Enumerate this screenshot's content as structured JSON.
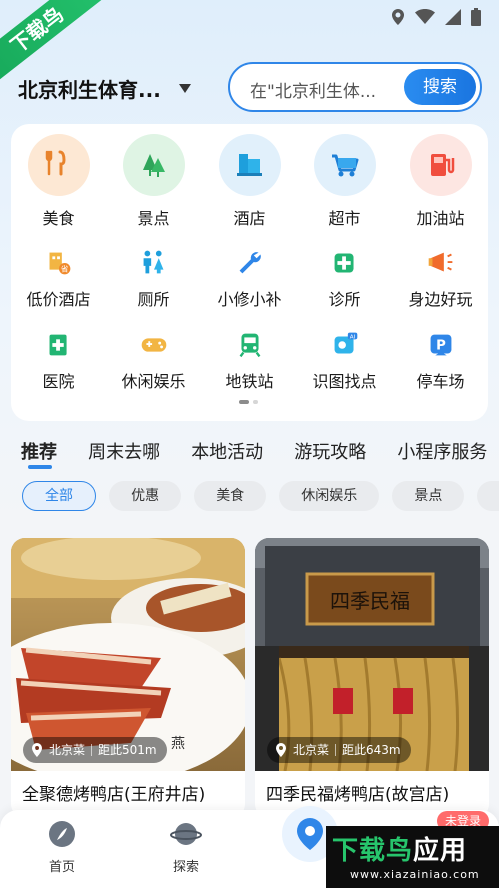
{
  "watermark": {
    "ribbon": "下载鸟",
    "brand_a": "下载鸟",
    "brand_b": "应用",
    "url": "www.xiazainiao.com"
  },
  "status_bar": {
    "icons": [
      "location-icon",
      "wifi-icon",
      "signal-icon",
      "battery-icon"
    ]
  },
  "location": {
    "city": "北京利生体育...",
    "caret": "chevron-down-icon"
  },
  "search": {
    "placeholder": "在\"北京利生体...",
    "button": "搜索"
  },
  "categories": [
    {
      "label": "美食",
      "icon": "food-icon"
    },
    {
      "label": "景点",
      "icon": "scenic-icon"
    },
    {
      "label": "酒店",
      "icon": "hotel-icon"
    },
    {
      "label": "超市",
      "icon": "supermarket-icon"
    },
    {
      "label": "加油站",
      "icon": "gas-station-icon"
    },
    {
      "label": "低价酒店",
      "icon": "budget-hotel-icon"
    },
    {
      "label": "厕所",
      "icon": "toilet-icon"
    },
    {
      "label": "小修小补",
      "icon": "repair-icon"
    },
    {
      "label": "诊所",
      "icon": "clinic-icon"
    },
    {
      "label": "身边好玩",
      "icon": "fun-nearby-icon"
    },
    {
      "label": "医院",
      "icon": "hospital-icon"
    },
    {
      "label": "休闲娱乐",
      "icon": "leisure-icon"
    },
    {
      "label": "地铁站",
      "icon": "subway-icon"
    },
    {
      "label": "识图找点",
      "icon": "image-search-icon"
    },
    {
      "label": "停车场",
      "icon": "parking-icon"
    }
  ],
  "feed_tabs": [
    "推荐",
    "周末去哪",
    "本地活动",
    "游玩攻略",
    "小程序服务"
  ],
  "chips": [
    "全部",
    "优惠",
    "美食",
    "休闲娱乐",
    "景点",
    "酒"
  ],
  "cards": [
    {
      "cuisine": "北京菜",
      "distance": "距此501m",
      "title": "全聚德烤鸭店(王府井店)"
    },
    {
      "cuisine": "北京菜",
      "distance": "距此643m",
      "title": "四季民福烤鸭店(故宫店)",
      "sign_text": "四季民福"
    }
  ],
  "bottom_nav": [
    {
      "label": "首页",
      "icon": "home-compass-icon"
    },
    {
      "label": "探索",
      "icon": "planet-icon"
    },
    {
      "label": "",
      "icon": "map-pin-icon"
    }
  ],
  "login_badge": "未登录",
  "colors": {
    "accent": "#2f86e8",
    "brand_green": "#27c56c"
  }
}
